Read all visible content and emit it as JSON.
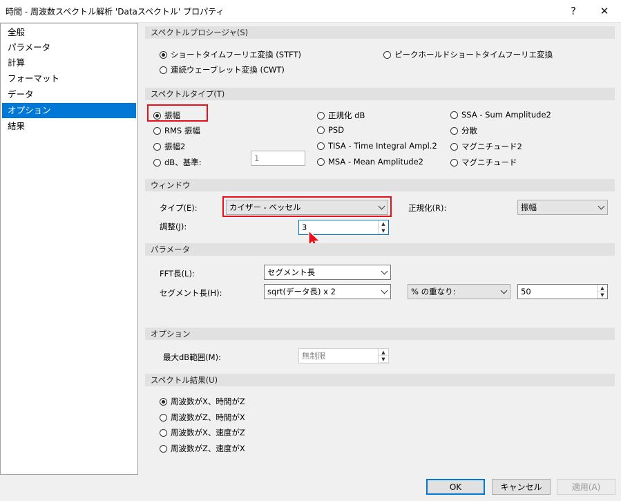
{
  "window": {
    "title": "時間 - 周波数スペクトル解析 'Dataスペクトル' プロパティ",
    "help": "?",
    "close": "✕"
  },
  "sidebar": {
    "items": [
      {
        "label": "全般"
      },
      {
        "label": "パラメータ"
      },
      {
        "label": "計算"
      },
      {
        "label": "フォーマット"
      },
      {
        "label": "データ"
      },
      {
        "label": "オプション",
        "selected": true
      },
      {
        "label": "結果"
      }
    ]
  },
  "spectrogram_section": {
    "title": "スペクトルプロシージャ(S)",
    "options": [
      "ショートタイムフーリエ変換 (STFT)",
      "ピークホールドショートタイムフーリエ変換",
      "連続ウェーブレット変換 (CWT)"
    ],
    "selected": 0
  },
  "spectrum_type": {
    "title": "スペクトルタイプ(T)",
    "options": [
      "振幅",
      "RMS 振幅",
      "振幅2",
      "dB、基準:",
      "正規化 dB",
      "PSD",
      "TISA - Time Integral Ampl.2",
      "MSA - Mean Amplitude2",
      "SSA - Sum Amplitude2",
      "分散",
      "マグニチュード2",
      "マグニチュード"
    ],
    "selected": 0,
    "db_reference_value": "1"
  },
  "window_section": {
    "title": "ウィンドウ",
    "type_label": "タイプ(E):",
    "type_value": "カイザー - ベッセル",
    "normalize_label": "正規化(R):",
    "normalize_value": "振幅",
    "adjust_label": "調整(J):",
    "adjust_value": "3"
  },
  "params_section": {
    "title": "パラメータ",
    "fft_label": "FFT長(L):",
    "fft_value": "セグメント長",
    "segment_label": "セグメント長(H):",
    "segment_value": "sqrt(データ長) x 2",
    "overlap_select": "% の重なり:",
    "overlap_value": "50"
  },
  "options_section": {
    "title": "オプション",
    "max_db_label": "最大dB範囲(M):",
    "max_db_value": "無制限"
  },
  "result_section": {
    "title": "スペクトル結果(U)",
    "options": [
      "周波数がX、時間がZ",
      "周波数がZ、時間がX",
      "周波数がX、速度がZ",
      "周波数がZ、速度がX"
    ],
    "selected": 0
  },
  "buttons": {
    "ok": "OK",
    "cancel": "キャンセル",
    "apply": "適用(A)"
  },
  "colors": {
    "accent": "#0078d7",
    "highlight": "#e8101a"
  }
}
